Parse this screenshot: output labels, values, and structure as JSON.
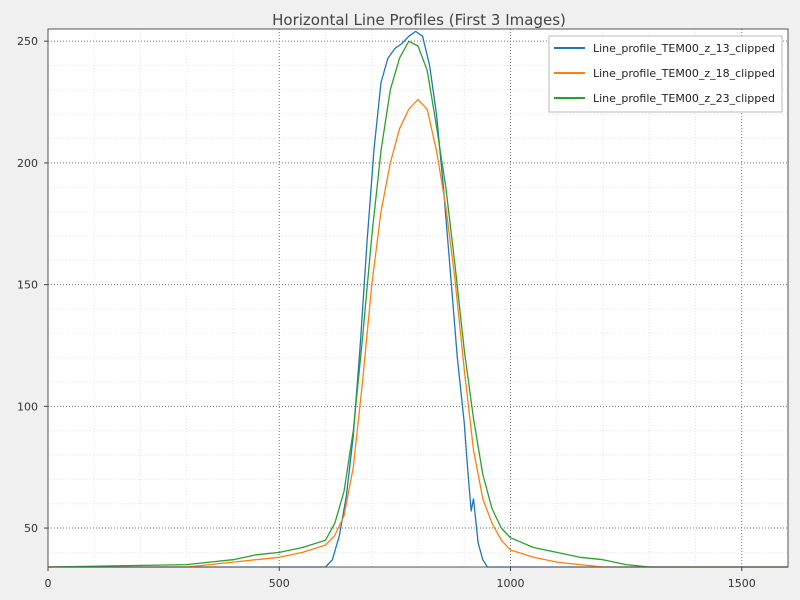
{
  "chart_data": {
    "type": "line",
    "title": "Horizontal Line Profiles (First 3 Images)",
    "xlabel": "",
    "ylabel": "",
    "xlim": [
      0,
      1600
    ],
    "ylim": [
      34,
      255
    ],
    "x_ticks": [
      0,
      500,
      1000,
      1500
    ],
    "y_ticks": [
      50,
      100,
      150,
      200,
      250
    ],
    "x_minor_step": 100,
    "y_minor_step": 10,
    "grid": true,
    "legend_position": "top-right",
    "series": [
      {
        "name": "Line_profile_TEM00_z_13_clipped",
        "color": "#1f77b4",
        "x": [
          0,
          300,
          600,
          615,
          630,
          645,
          660,
          675,
          690,
          705,
          720,
          735,
          750,
          765,
          780,
          795,
          810,
          825,
          840,
          855,
          870,
          885,
          900,
          905,
          910,
          915,
          920,
          925,
          930,
          940,
          950,
          1000,
          1600
        ],
        "y": [
          34,
          34,
          34,
          37,
          47,
          63,
          88,
          125,
          168,
          206,
          233,
          243,
          247,
          249,
          252,
          254,
          252,
          240,
          220,
          190,
          155,
          120,
          93,
          80,
          68,
          57,
          62,
          53,
          44,
          37,
          34,
          34,
          34
        ]
      },
      {
        "name": "Line_profile_TEM00_z_18_clipped",
        "color": "#ff7f0e",
        "x": [
          0,
          300,
          350,
          400,
          450,
          500,
          550,
          600,
          620,
          640,
          660,
          680,
          700,
          720,
          740,
          760,
          780,
          800,
          820,
          840,
          860,
          880,
          900,
          920,
          940,
          960,
          980,
          1000,
          1050,
          1100,
          1150,
          1200,
          1300,
          1600
        ],
        "y": [
          34,
          34,
          35,
          36,
          37,
          38,
          40,
          43,
          47,
          55,
          75,
          110,
          150,
          180,
          200,
          214,
          222,
          226,
          222,
          205,
          182,
          152,
          115,
          82,
          62,
          52,
          45,
          41,
          38,
          36,
          35,
          34,
          34,
          34
        ]
      },
      {
        "name": "Line_profile_TEM00_z_23_clipped",
        "color": "#2ca02c",
        "x": [
          0,
          300,
          350,
          400,
          450,
          500,
          550,
          600,
          620,
          640,
          660,
          680,
          700,
          720,
          740,
          760,
          780,
          800,
          820,
          840,
          860,
          880,
          900,
          920,
          940,
          960,
          980,
          1000,
          1050,
          1100,
          1150,
          1200,
          1250,
          1300,
          1600
        ],
        "y": [
          34,
          35,
          36,
          37,
          39,
          40,
          42,
          45,
          52,
          65,
          90,
          128,
          170,
          205,
          230,
          243,
          250,
          248,
          238,
          215,
          190,
          158,
          123,
          95,
          72,
          58,
          50,
          46,
          42,
          40,
          38,
          37,
          35,
          34,
          34
        ]
      }
    ]
  }
}
